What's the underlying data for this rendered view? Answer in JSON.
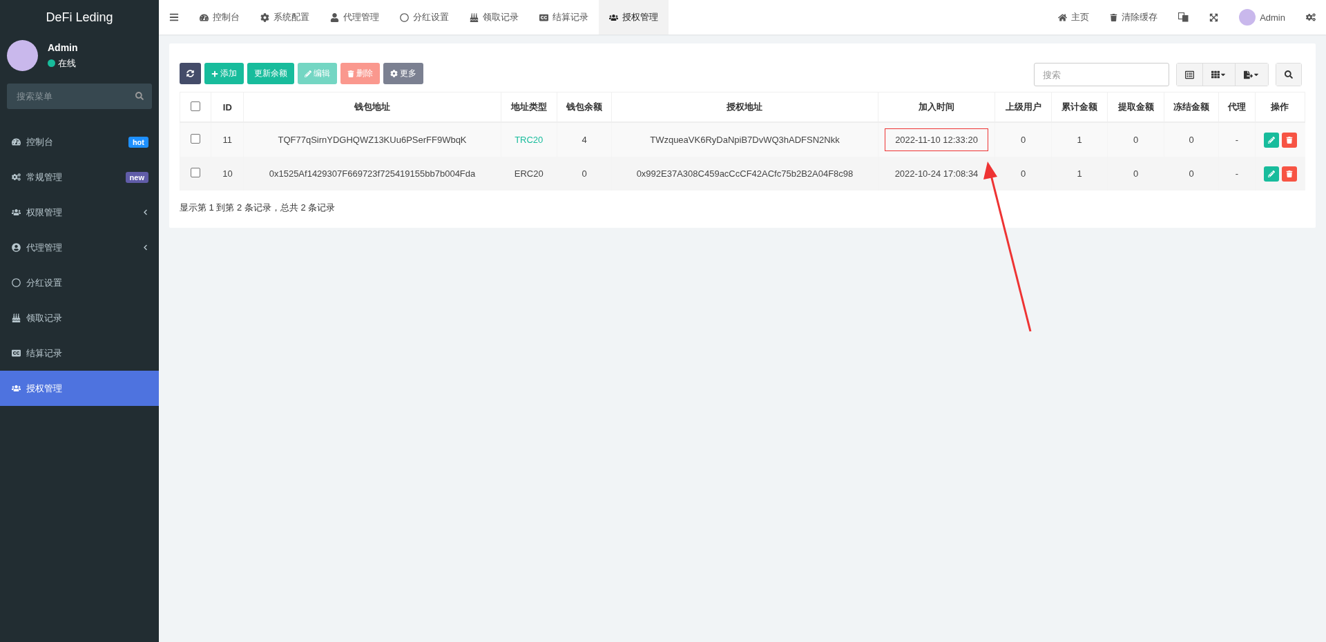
{
  "brand": "DeFi Leding",
  "user": {
    "name": "Admin",
    "status": "在线"
  },
  "sidebar": {
    "search": {
      "placeholder": "搜索菜单"
    },
    "items": [
      {
        "label": "控制台",
        "badge": "hot",
        "color": "#1e90ff",
        "has_children": false,
        "selected": false
      },
      {
        "label": "常规管理",
        "badge": "new",
        "color": "#605ca8",
        "has_children": false,
        "selected": false
      },
      {
        "label": "权限管理",
        "has_children": true,
        "selected": false
      },
      {
        "label": "代理管理",
        "has_children": true,
        "selected": false
      },
      {
        "label": "分红设置",
        "has_children": false,
        "selected": false
      },
      {
        "label": "领取记录",
        "has_children": false,
        "selected": false
      },
      {
        "label": "结算记录",
        "has_children": false,
        "selected": false
      },
      {
        "label": "授权管理",
        "has_children": false,
        "selected": true
      }
    ]
  },
  "tabs": [
    {
      "label": "控制台",
      "selected": false
    },
    {
      "label": "系统配置",
      "selected": false
    },
    {
      "label": "代理管理",
      "selected": false
    },
    {
      "label": "分红设置",
      "selected": false
    },
    {
      "label": "领取记录",
      "selected": false
    },
    {
      "label": "结算记录",
      "selected": false
    },
    {
      "label": "授权管理",
      "selected": true
    }
  ],
  "topbar_right": {
    "home": "主页",
    "clear_cache": "清除缓存",
    "user": "Admin"
  },
  "toolbar": {
    "buttons": [
      {
        "kind": "refresh",
        "disabled": false
      },
      {
        "kind": "add",
        "label": "添加",
        "disabled": false
      },
      {
        "kind": "update",
        "label": "更新余额",
        "disabled": false
      },
      {
        "kind": "edit",
        "label": "编辑",
        "disabled": true
      },
      {
        "kind": "delete",
        "label": "删除",
        "disabled": true
      },
      {
        "kind": "more",
        "label": "更多",
        "disabled": false
      }
    ],
    "search": {
      "placeholder": "搜索"
    }
  },
  "table": {
    "select_all_checked": false,
    "columns": [
      "ID",
      "钱包地址",
      "地址类型",
      "钱包余额",
      "授权地址",
      "加入时间",
      "上级用户",
      "累计金额",
      "提取金额",
      "冻结金额",
      "代理",
      "操作"
    ],
    "rows": [
      {
        "checked": false,
        "highlighted": true,
        "color": "#18bc9c",
        "cells": [
          "11",
          "TQF77qSirnYDGHQWZ13KUu6PSerFF9WbqK",
          "TRC20",
          "4",
          "TWzqueaVK6RyDaNpiB7DvWQ3hADFSN2Nkk",
          "2022-11-10 12:33:20",
          "0",
          "1",
          "0",
          "0",
          "-"
        ]
      },
      {
        "checked": false,
        "highlighted": false,
        "color": "#444444",
        "cells": [
          "10",
          "0x1525Af1429307F669723f725419155bb7b004Fda",
          "ERC20",
          "0",
          "0x992E37A308C459acCcCF42ACfc75b2B2A04F8c98",
          "2022-10-24 17:08:34",
          "0",
          "1",
          "0",
          "0",
          "-"
        ]
      }
    ]
  },
  "pagination_info": "显示第 1 到第 2 条记录，总共 2 条记录"
}
